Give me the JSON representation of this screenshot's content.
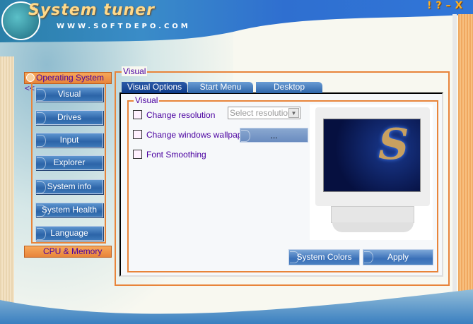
{
  "app": {
    "title": "System tuner",
    "url": "WWW.SOFTDEPO.COM",
    "window_controls": [
      "!",
      "?",
      "–",
      "X"
    ]
  },
  "sidebar": {
    "header": "Operating System <<",
    "items": [
      "Visual",
      "Drives",
      "Input",
      "Explorer",
      "System info",
      "System Health",
      "Language"
    ],
    "footer": "CPU & Memory"
  },
  "main": {
    "group_label": "Visual",
    "tabs": [
      "Visual Options",
      "Start Menu",
      "Desktop"
    ],
    "active_tab": 0,
    "inner_group_label": "Visual",
    "options": [
      {
        "label": "Change resolution",
        "checked": false
      },
      {
        "label": "Change windows wallpaper",
        "checked": false
      },
      {
        "label": "Font Smoothing",
        "checked": false
      }
    ],
    "resolution_select": "Select resolution",
    "browse_button": "...",
    "system_colors_button": "System Colors",
    "apply_button": "Apply"
  },
  "colors": {
    "accent": "#e8843a",
    "text": "#4a00a0",
    "button": "#2c64a8"
  }
}
